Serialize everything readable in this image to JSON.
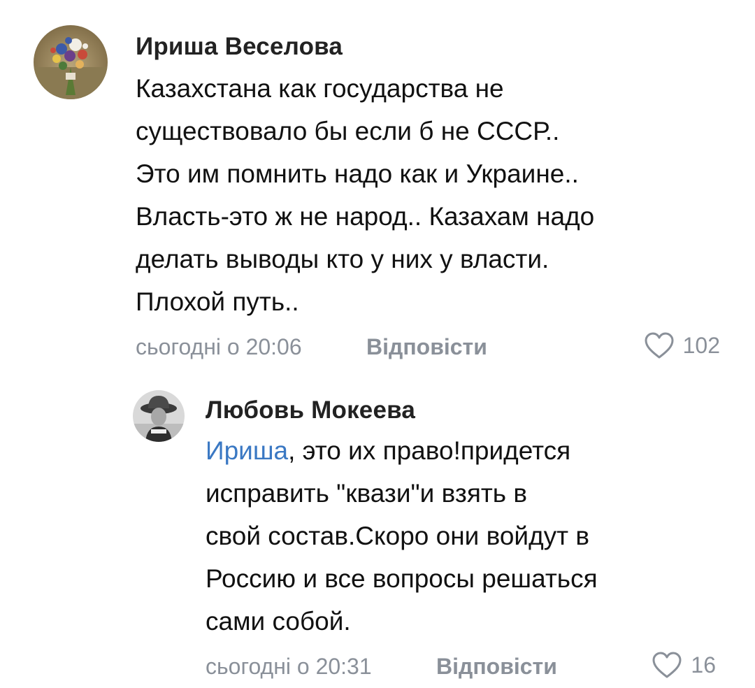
{
  "comments": [
    {
      "author": "Ириша Веселова",
      "mention": "",
      "text": "Казахстана как государства не\nсуществовало бы если б не СССР..\nЭто им помнить надо как и Украине..\nВласть-это ж не народ.. Казахам надо\nделать выводы кто у них у власти.\nПлохой путь..",
      "time": "сьогодні о 20:06",
      "reply_label": "Відповісти",
      "likes": "102",
      "avatar_icon": "flower-bouquet-avatar"
    },
    {
      "author": "Любовь Мокеева",
      "mention": "Ириша",
      "text": ", это их право!придется\nисправить \"квази\"и взять в\nсвой состав.Скоро они войдут в\nРоссию и все вопросы решаться\nсами собой.",
      "time": "сьогодні о 20:31",
      "reply_label": "Відповісти",
      "likes": "16",
      "avatar_icon": "woman-in-hat-avatar"
    }
  ],
  "colors": {
    "mention": "#3a78c3",
    "meta": "#8a9099",
    "author": "#222222"
  }
}
